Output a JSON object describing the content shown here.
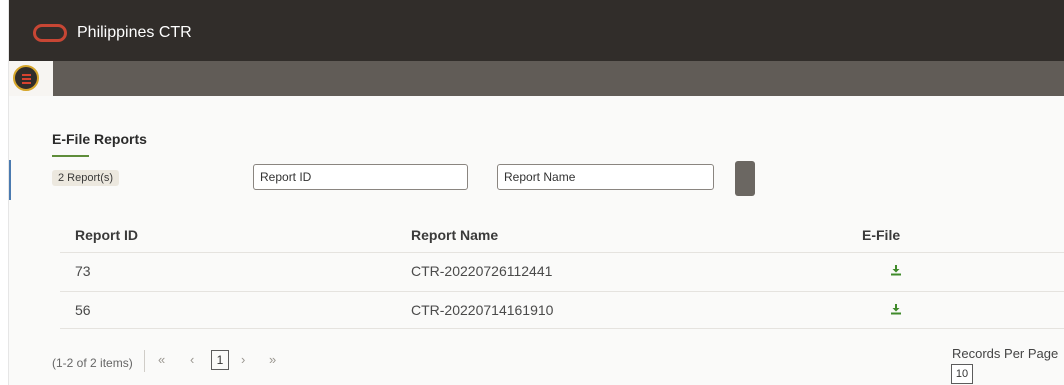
{
  "header": {
    "title": "Philippines CTR"
  },
  "page": {
    "heading": "E-File Reports",
    "count_badge": "2 Report(s)"
  },
  "filters": {
    "report_id_placeholder": "Report ID",
    "report_name_placeholder": "Report Name"
  },
  "table": {
    "columns": [
      "Report ID",
      "Report Name",
      "E-File"
    ],
    "rows": [
      {
        "report_id": "73",
        "report_name": "CTR-20220726112441",
        "efile_icon": "download-icon"
      },
      {
        "report_id": "56",
        "report_name": "CTR-20220714161910",
        "efile_icon": "download-icon"
      }
    ]
  },
  "pagination": {
    "summary": "(1-2 of 2 items)",
    "first": "«",
    "prev": "‹",
    "current_page": "1",
    "next": "›",
    "last": "»",
    "records_per_page_label": "Records Per Page",
    "records_per_page_value": "10"
  },
  "colors": {
    "header_bg": "#312d2a",
    "subbar_bg": "#615c57",
    "accent_green": "#5e8d3a",
    "download_green": "#3f8a2a",
    "logo_red": "#c74634"
  }
}
